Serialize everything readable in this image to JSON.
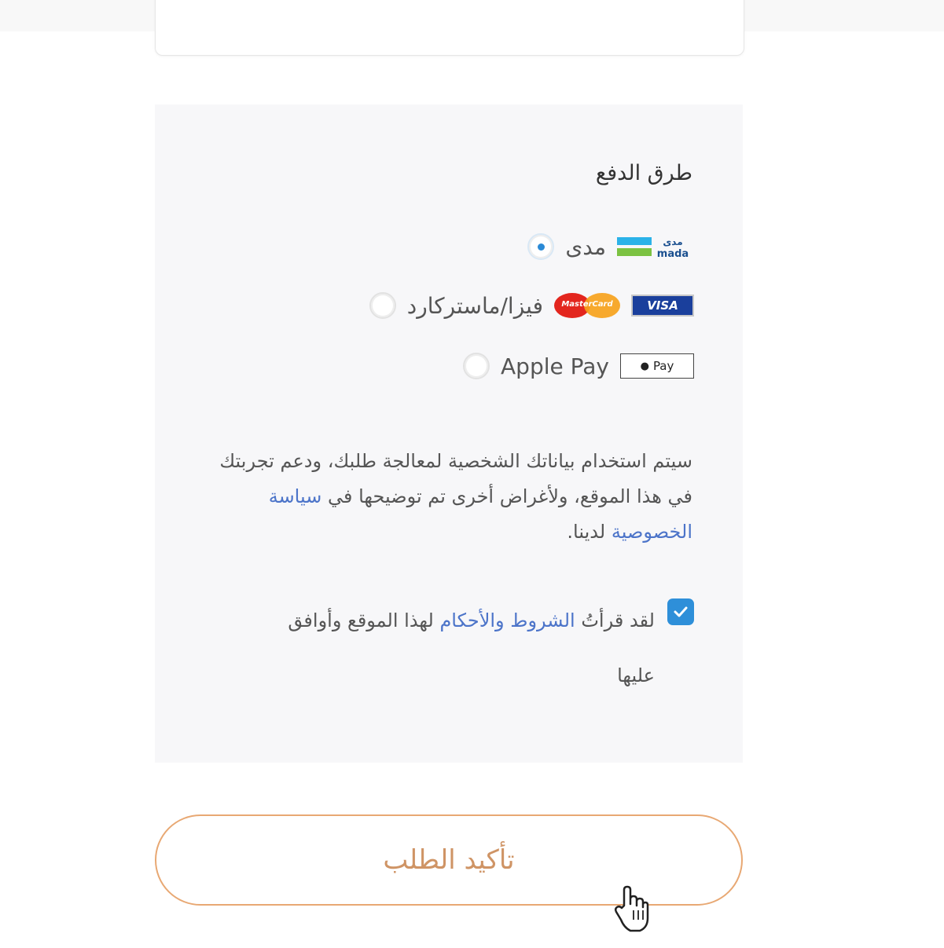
{
  "payment": {
    "title": "طرق الدفع",
    "methods": [
      {
        "label": "مدى",
        "logo_text": "مدى",
        "logo_sub": "mada",
        "selected": true
      },
      {
        "label": "فيزا/ماستركارد",
        "visa_text": "VISA",
        "mc_text": "MasterCard",
        "selected": false
      },
      {
        "label": "Apple Pay",
        "logo_text": "Pay",
        "selected": false
      }
    ]
  },
  "privacy": {
    "text_before": "سيتم استخدام بياناتك الشخصية لمعالجة طلبك، ودعم تجربتك في هذا الموقع، ولأغراض أخرى تم توضيحها في ",
    "link": "سياسة الخصوصية",
    "text_after": " لدينا."
  },
  "terms": {
    "checked": true,
    "text_before": "لقد قرأتُ ",
    "link": "الشروط والأحكام",
    "text_after": " لهذا الموقع وأوافق عليها"
  },
  "confirm_button": {
    "label": "تأكيد الطلب"
  },
  "colors": {
    "accent_blue": "#2e8fd9",
    "link": "#4c74c9",
    "button_border": "#e8a873",
    "button_text": "#cf9465"
  }
}
